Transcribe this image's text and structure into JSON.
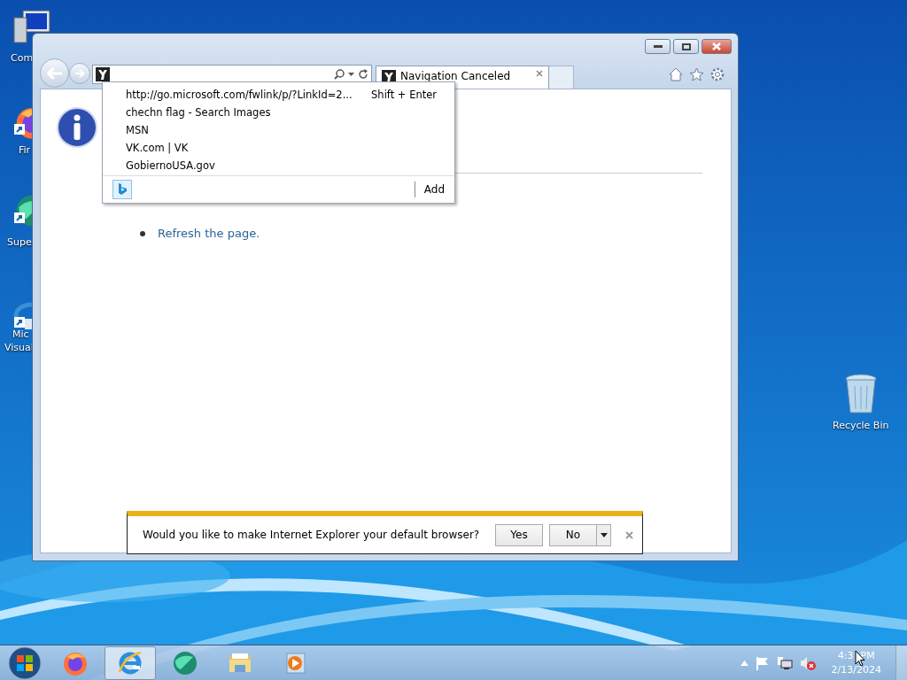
{
  "desktop": {
    "icons": [
      {
        "kind": "computer",
        "lines": [
          "Com"
        ]
      },
      {
        "kind": "firefox",
        "lines": [
          "Fir"
        ]
      },
      {
        "kind": "globe",
        "lines": [
          "Supe"
        ]
      },
      {
        "kind": "studio",
        "lines": [
          "Mic",
          "Visual"
        ]
      }
    ],
    "recycle_bin": {
      "label": "Recycle Bin"
    }
  },
  "browser": {
    "tabs": [
      {
        "title": "Navigation Canceled",
        "selected": true
      }
    ],
    "suggestions": {
      "items": [
        {
          "text": "http://go.microsoft.com/fwlink/p/?LinkId=2...",
          "hint": "Shift + Enter"
        },
        {
          "text": "chechn flag - Search Images"
        },
        {
          "text": "MSN"
        },
        {
          "text": "VK.com | VK"
        },
        {
          "text": "GobiernoUSA.gov"
        }
      ],
      "add_label": "Add"
    },
    "page": {
      "link": "Refresh the page."
    },
    "notification": {
      "message": "Would you like to make Internet Explorer your default browser?",
      "buttons": [
        {
          "label": "Yes",
          "kind": "plain"
        },
        {
          "label": "No",
          "kind": "split"
        }
      ]
    }
  },
  "taskbar": {
    "apps": [
      {
        "kind": "firefox",
        "selected": false
      },
      {
        "kind": "ie",
        "selected": true
      },
      {
        "kind": "globe",
        "selected": false
      },
      {
        "kind": "folder",
        "selected": false
      },
      {
        "kind": "media",
        "selected": false
      }
    ],
    "clock": {
      "time": "4:3",
      "period": "PM",
      "date": "2/13/2024"
    }
  }
}
